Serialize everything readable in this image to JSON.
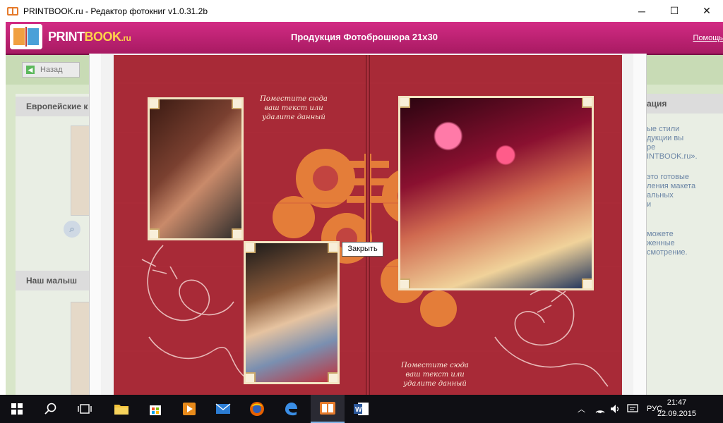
{
  "window": {
    "title": "PRINTBOOK.ru - Редактор фотокниг v1.0.31.2b",
    "minimize_glyph": "─",
    "maximize_glyph": "☐",
    "close_glyph": "✕"
  },
  "header": {
    "logo_print": "PRINT",
    "logo_book": "BOOK",
    "logo_ru": ".ru",
    "title": "Продукция Фотоброшюра 21x30",
    "help": "Помощь"
  },
  "toolbar": {
    "back_label": "Назад"
  },
  "left_panel": {
    "categories": [
      {
        "label": "Европейские к"
      },
      {
        "label": "Наш малыш"
      }
    ]
  },
  "right_panel": {
    "title": "ация",
    "lines": [
      "ые стили",
      "дукции вы",
      "ре",
      "INTBOOK.ru».",
      "",
      "это готовые",
      "ления макета",
      "альных",
      "и",
      "",
      "можете",
      "женные",
      "смотрение."
    ]
  },
  "spread": {
    "text_placeholder_top": "Поместите сюда\nваш текст или\nудалите данный",
    "text_placeholder_bottom": "Поместите сюда\nваш текст или\nудалите данный"
  },
  "tooltip": {
    "text": "Закрыть"
  },
  "taskbar": {
    "lang": "РУС",
    "time": "21:47",
    "date": "22.09.2015"
  },
  "colors": {
    "header": "#c4236f",
    "page_red": "#a82a37",
    "ornament": "#e8823a",
    "panel_bg": "#d8e6c9"
  }
}
